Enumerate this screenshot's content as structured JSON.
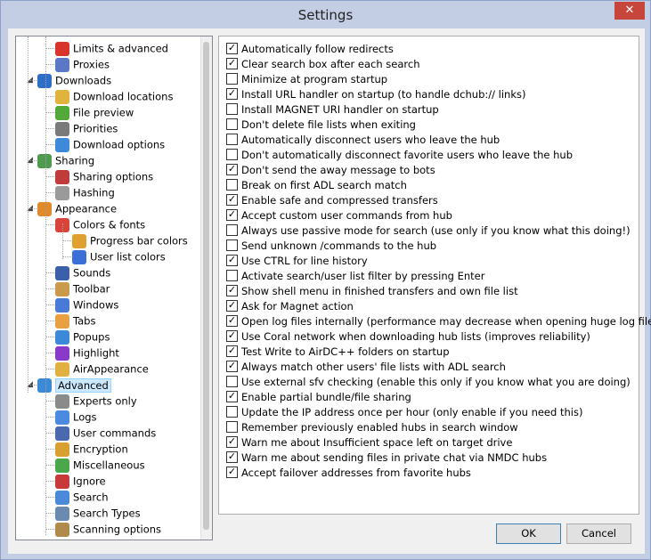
{
  "window": {
    "title": "Settings",
    "close_glyph": "✕"
  },
  "tree": {
    "items": [
      {
        "label": "Limits & advanced",
        "level": 2,
        "icon": "limits-icon",
        "color": "#d9342b"
      },
      {
        "label": "Proxies",
        "level": 2,
        "icon": "proxies-icon",
        "color": "#5b78c7"
      },
      {
        "label": "Downloads",
        "level": 1,
        "icon": "downloads-icon",
        "color": "#2f6ec7",
        "expanded": true
      },
      {
        "label": "Download locations",
        "level": 2,
        "icon": "folder-icon",
        "color": "#e0b33c"
      },
      {
        "label": "File preview",
        "level": 2,
        "icon": "play-icon",
        "color": "#53a83a"
      },
      {
        "label": "Priorities",
        "level": 2,
        "icon": "priorities-icon",
        "color": "#7a7a7a"
      },
      {
        "label": "Download options",
        "level": 2,
        "icon": "download-options-icon",
        "color": "#3c8ad8"
      },
      {
        "label": "Sharing",
        "level": 1,
        "icon": "sharing-icon",
        "color": "#4e9a4e",
        "expanded": true
      },
      {
        "label": "Sharing options",
        "level": 2,
        "icon": "sharing-options-icon",
        "color": "#c23b3b"
      },
      {
        "label": "Hashing",
        "level": 2,
        "icon": "hashing-icon",
        "color": "#9a9a9a"
      },
      {
        "label": "Appearance",
        "level": 1,
        "icon": "appearance-icon",
        "color": "#e08a2b",
        "expanded": true
      },
      {
        "label": "Colors & fonts",
        "level": 2,
        "icon": "colors-icon",
        "color": "#d8443a",
        "expanded": true
      },
      {
        "label": "Progress bar colors",
        "level": 3,
        "icon": "progress-colors-icon",
        "color": "#e0a030"
      },
      {
        "label": "User list colors",
        "level": 3,
        "icon": "user-list-colors-icon",
        "color": "#3a6fd8"
      },
      {
        "label": "Sounds",
        "level": 2,
        "icon": "sounds-icon",
        "color": "#3b5fa8"
      },
      {
        "label": "Toolbar",
        "level": 2,
        "icon": "toolbar-icon",
        "color": "#c89a4a"
      },
      {
        "label": "Windows",
        "level": 2,
        "icon": "windows-icon",
        "color": "#4a7ad8"
      },
      {
        "label": "Tabs",
        "level": 2,
        "icon": "tabs-icon",
        "color": "#e8a040"
      },
      {
        "label": "Popups",
        "level": 2,
        "icon": "popups-icon",
        "color": "#3a8ad8"
      },
      {
        "label": "Highlight",
        "level": 2,
        "icon": "highlight-icon",
        "color": "#8a3ac8"
      },
      {
        "label": "AirAppearance",
        "level": 2,
        "icon": "air-appearance-icon",
        "color": "#e0b040"
      },
      {
        "label": "Advanced",
        "level": 1,
        "icon": "advanced-icon",
        "color": "#3a8ad8",
        "expanded": true,
        "selected": true
      },
      {
        "label": "Experts only",
        "level": 2,
        "icon": "experts-icon",
        "color": "#8a8a8a"
      },
      {
        "label": "Logs",
        "level": 2,
        "icon": "logs-icon",
        "color": "#4a8ae0"
      },
      {
        "label": "User commands",
        "level": 2,
        "icon": "user-commands-icon",
        "color": "#4a6ab0"
      },
      {
        "label": "Encryption",
        "level": 2,
        "icon": "lock-icon",
        "color": "#d8a030"
      },
      {
        "label": "Miscellaneous",
        "level": 2,
        "icon": "pencil-icon",
        "color": "#4aa84a"
      },
      {
        "label": "Ignore",
        "level": 2,
        "icon": "ignore-icon",
        "color": "#c83a3a"
      },
      {
        "label": "Search",
        "level": 2,
        "icon": "search-icon",
        "color": "#4a8ad8"
      },
      {
        "label": "Search Types",
        "level": 2,
        "icon": "search-types-icon",
        "color": "#6a8ab0"
      },
      {
        "label": "Scanning options",
        "level": 2,
        "icon": "scanning-icon",
        "color": "#b08a4a"
      }
    ]
  },
  "options": [
    {
      "label": "Automatically follow redirects",
      "checked": true
    },
    {
      "label": "Clear search box after each search",
      "checked": true
    },
    {
      "label": "Minimize at program startup",
      "checked": false
    },
    {
      "label": "Install URL handler on startup (to handle dchub:// links)",
      "checked": true
    },
    {
      "label": "Install MAGNET URI handler on startup",
      "checked": false
    },
    {
      "label": "Don't delete file lists when exiting",
      "checked": false
    },
    {
      "label": "Automatically disconnect users who leave the hub",
      "checked": false
    },
    {
      "label": "Don't automatically disconnect favorite users who leave the hub",
      "checked": false
    },
    {
      "label": "Don't send the away message to bots",
      "checked": true
    },
    {
      "label": "Break on first ADL search match",
      "checked": false
    },
    {
      "label": "Enable safe and compressed transfers",
      "checked": true
    },
    {
      "label": "Accept custom user commands from hub",
      "checked": true
    },
    {
      "label": "Always use passive mode for search (use only if you know what this doing!)",
      "checked": false
    },
    {
      "label": "Send unknown /commands to the hub",
      "checked": false
    },
    {
      "label": "Use CTRL for line history",
      "checked": true
    },
    {
      "label": "Activate search/user list filter by pressing Enter",
      "checked": false
    },
    {
      "label": "Show shell menu in finished transfers and own file list",
      "checked": true
    },
    {
      "label": "Ask for Magnet action",
      "checked": true
    },
    {
      "label": "Open log files internally (performance may decrease when opening huge log files)",
      "checked": true
    },
    {
      "label": "Use Coral network when downloading hub lists (improves reliability)",
      "checked": true
    },
    {
      "label": "Test Write to AirDC++ folders on startup",
      "checked": true
    },
    {
      "label": "Always match other users' file lists with ADL search",
      "checked": true
    },
    {
      "label": "Use external sfv checking (enable this only if you know what you are doing)",
      "checked": false
    },
    {
      "label": "Enable partial bundle/file sharing",
      "checked": true
    },
    {
      "label": "Update the IP address once per hour (only enable if you need this)",
      "checked": false
    },
    {
      "label": "Remember previously enabled hubs in search window",
      "checked": false
    },
    {
      "label": "Warn me about Insufficient space left on target drive",
      "checked": true
    },
    {
      "label": "Warn me about sending files in private chat via NMDC hubs",
      "checked": true
    },
    {
      "label": "Accept failover addresses from favorite hubs",
      "checked": true
    }
  ],
  "buttons": {
    "ok": "OK",
    "cancel": "Cancel"
  }
}
